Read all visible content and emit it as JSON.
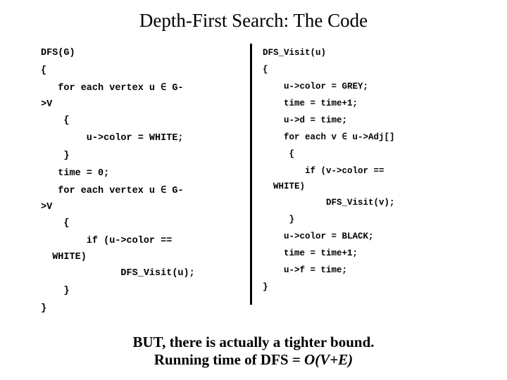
{
  "slide": {
    "title": "Depth-First Search: The Code",
    "background_color": "#ffffff",
    "text_color": "#000000"
  },
  "divider": {
    "color": "#000000"
  },
  "left_code": {
    "name": "DFS(G)",
    "lines": [
      {
        "text": "DFS(G)",
        "wrap": false
      },
      {
        "text": "{",
        "wrap": false
      },
      {
        "text": "   for each vertex u ∈ G-",
        "wrap": false
      },
      {
        "text": ">V",
        "wrap": true
      },
      {
        "text": "    {",
        "wrap": false
      },
      {
        "text": "        u->color = WHITE;",
        "wrap": false
      },
      {
        "text": "    }",
        "wrap": false
      },
      {
        "text": "   time = 0;",
        "wrap": false
      },
      {
        "text": "   for each vertex u ∈ G-",
        "wrap": false
      },
      {
        "text": ">V",
        "wrap": true
      },
      {
        "text": "    {",
        "wrap": false
      },
      {
        "text": "        if (u->color ==",
        "wrap": false
      },
      {
        "text": "  WHITE)",
        "wrap": true
      },
      {
        "text": "              DFS_Visit(u);",
        "wrap": false
      },
      {
        "text": "    }",
        "wrap": false
      },
      {
        "text": "}",
        "wrap": false
      }
    ]
  },
  "right_code": {
    "name": "DFS_Visit(u)",
    "lines": [
      {
        "text": "DFS_Visit(u)",
        "wrap": false
      },
      {
        "text": "{",
        "wrap": false
      },
      {
        "text": "    u->color = GREY;",
        "wrap": false
      },
      {
        "text": "    time = time+1;",
        "wrap": false
      },
      {
        "text": "    u->d = time;",
        "wrap": false
      },
      {
        "text": "    for each v ∈ u->Adj[]",
        "wrap": false
      },
      {
        "text": "     {",
        "wrap": false
      },
      {
        "text": "        if (v->color ==",
        "wrap": false
      },
      {
        "text": "  WHITE)",
        "wrap": true
      },
      {
        "text": "            DFS_Visit(v);",
        "wrap": false
      },
      {
        "text": "     }",
        "wrap": false
      },
      {
        "text": "    u->color = BLACK;",
        "wrap": false
      },
      {
        "text": "    time = time+1;",
        "wrap": false
      },
      {
        "text": "    u->f = time;",
        "wrap": false
      },
      {
        "text": "}",
        "wrap": false
      }
    ]
  },
  "conclusion": {
    "line1": "BUT, there is actually a tighter bound.",
    "line2_prefix": "Running time of DFS = ",
    "line2_bigoh": "O(V+E)"
  }
}
